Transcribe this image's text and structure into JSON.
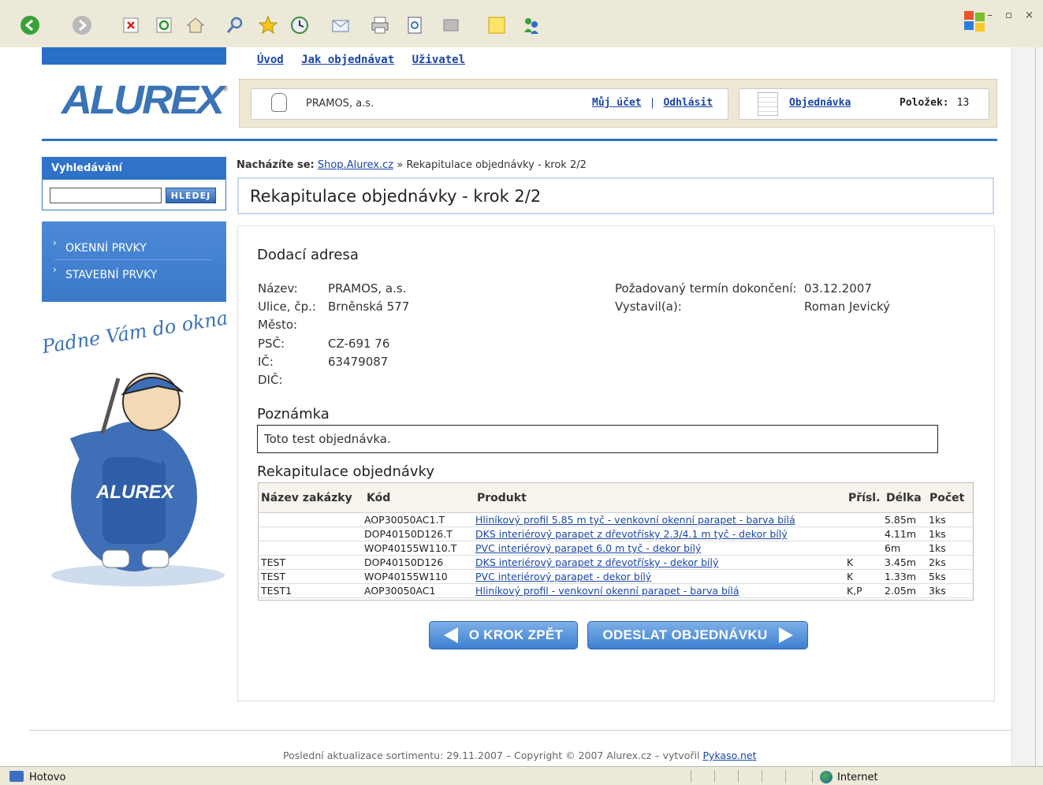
{
  "browser": {
    "status": "Hotovo",
    "zone": "Internet",
    "window_controls": "– ▫ ×"
  },
  "header": {
    "nav": [
      "Úvod",
      "Jak objednávat",
      "Uživatel"
    ],
    "logo": "ALUREX",
    "logo_mark": "®",
    "company": "PRAMOS, a.s.",
    "my_account": "Můj účet",
    "separator": "|",
    "logout": "Odhlásit",
    "order_link": "Objednávka",
    "items_label": "Položek:",
    "items_count": "13"
  },
  "sidebar": {
    "search_title": "Vyhledávání",
    "search_value": "",
    "search_button": "HLEDEJ",
    "categories": [
      "OKENNÍ PRVKY",
      "STAVEBNÍ PRVKY"
    ],
    "slogan": "Padne Vám do okna",
    "mascot_text": "ALUREX"
  },
  "breadcrumb": {
    "prefix": "Nacházíte se:",
    "home": "Shop.Alurex.cz",
    "sep": "»",
    "current": "Rekapitulace objednávky - krok 2/2"
  },
  "page_title": "Rekapitulace objednávky - krok 2/2",
  "delivery": {
    "heading": "Dodací adresa",
    "labels": [
      "Název:",
      "Ulice, čp.:",
      "Město:",
      "PSČ:",
      "IČ:",
      "DIČ:"
    ],
    "values": [
      "PRAMOS, a.s.",
      "Brněnská 577",
      "",
      "CZ-691 76",
      "63479087",
      ""
    ],
    "right_labels": [
      "Požadovaný termín dokončení:",
      "Vystavil(a):"
    ],
    "right_values": [
      "03.12.2007",
      "Roman Jevický"
    ]
  },
  "note": {
    "heading": "Poznámka",
    "text": "Toto test objednávka."
  },
  "recap": {
    "heading": "Rekapitulace objednávky",
    "columns": [
      "Název zakázky",
      "Kód",
      "Produkt",
      "Přísl.",
      "Délka",
      "Počet"
    ],
    "rows": [
      [
        "",
        "AOP30050AC1.T",
        "Hliníkový profil 5.85 m tyč - venkovní okenní parapet - barva bílá",
        "",
        "5.85m",
        "1ks"
      ],
      [
        "",
        "DOP40150D126.T",
        "DKS interiérový parapet z dřevotřísky 2.3/4.1 m tyč - dekor bílý",
        "",
        "4.11m",
        "1ks"
      ],
      [
        "",
        "WOP40155W110.T",
        "PVC interiérový parapet 6.0 m tyč - dekor bílý",
        "",
        "6m",
        "1ks"
      ],
      [
        "TEST",
        "DOP40150D126",
        "DKS interiérový parapet z dřevotřísky - dekor bílý",
        "K",
        "3.45m",
        "2ks"
      ],
      [
        "TEST",
        "WOP40155W110",
        "PVC interiérový parapet - dekor bílý",
        "K",
        "1.33m",
        "5ks"
      ],
      [
        "TEST1",
        "AOP30050AC1",
        "Hliníkový profil - venkovní okenní parapet - barva bílá",
        "K,P",
        "2.05m",
        "3ks"
      ]
    ]
  },
  "buttons": {
    "back": "O KROK ZPĚT",
    "send": "ODESLAT OBJEDNÁVKU"
  },
  "footer": {
    "text": "Poslední aktualizace sortimentu: 29.11.2007 – Copyright © 2007 Alurex.cz – vytvořil",
    "link": "Pykaso.net"
  }
}
